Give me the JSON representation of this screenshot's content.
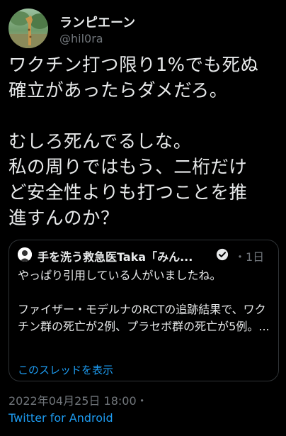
{
  "author": {
    "display_name": "ランピエーン",
    "handle": "@hil0ra",
    "avatar_icon": "giraffe-avatar-photo"
  },
  "tweet": {
    "text": "ワクチン打つ限り1%でも死ぬ\n確立があったらダメだろ。\n\nむしろ死んでるしな。\n私の周りではもう、二桁だけ\nど安全性よりも打つことを推\n進すんのか？"
  },
  "quote": {
    "name": "手を洗う救急医Taka「みん...",
    "verified_icon": "verified-badge-icon",
    "time": "・1日",
    "text": "やっぱり引用している人がいましたね。\n\nファイザー・モデルナのRCTの追跡結果で、ワクチン群の死亡が2例、プラセボ群の死亡が5例。...",
    "thread_link": "このスレッドを表示"
  },
  "meta": {
    "timestamp": "2022年04月25日 18:00",
    "dot": "・",
    "source": "Twitter for Android"
  },
  "colors": {
    "background": "#000000",
    "text": "#e7e9ea",
    "secondary": "#71767b",
    "link": "#1d9bf0",
    "border": "#2f3336"
  }
}
